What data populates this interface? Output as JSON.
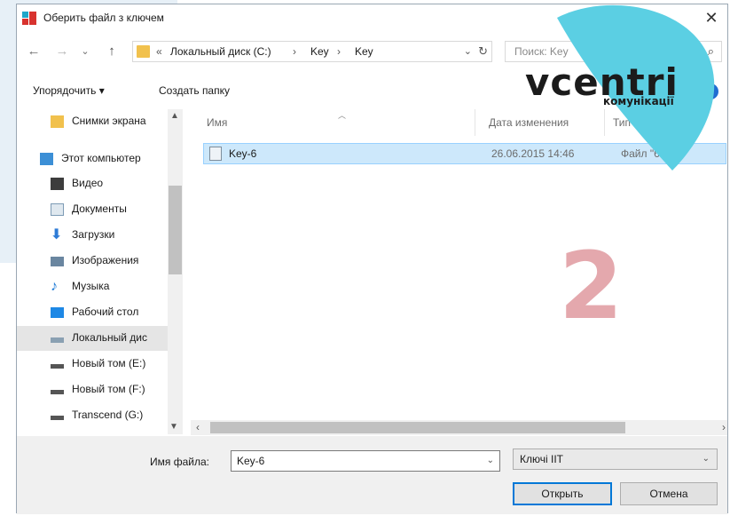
{
  "window": {
    "title": "Оберить файл з ключем",
    "close_glyph": "✕"
  },
  "nav": {
    "back": "←",
    "forward": "→",
    "recent": "⌄",
    "up": "↑"
  },
  "address": {
    "prefix": "«",
    "crumbs": [
      "Локальный диск (C:)",
      "Key",
      "Key"
    ],
    "separator": "›",
    "dropdown": "⌄",
    "refresh": "↻"
  },
  "search": {
    "placeholder": "Поиск: Key",
    "icon": "search-icon"
  },
  "commands": {
    "organize": "Упорядочить ▾",
    "new_folder": "Создать папку",
    "help": "?"
  },
  "sidebar": {
    "items": [
      {
        "label": "Снимки экрана",
        "icon": "folder-icon",
        "color": "#f1c14d"
      },
      {
        "label": "Этот компьютер",
        "icon": "computer-icon",
        "color": "#3c8fd6"
      },
      {
        "label": "Видео",
        "icon": "video-icon",
        "color": "#3d3d3d"
      },
      {
        "label": "Документы",
        "icon": "documents-icon",
        "color": "#7d9bb5"
      },
      {
        "label": "Загрузки",
        "icon": "downloads-icon",
        "color": "#2e7bd6"
      },
      {
        "label": "Изображения",
        "icon": "pictures-icon",
        "color": "#6a86a0"
      },
      {
        "label": "Музыка",
        "icon": "music-icon",
        "color": "#1c7ad6"
      },
      {
        "label": "Рабочий стол",
        "icon": "desktop-icon",
        "color": "#1e88e5"
      },
      {
        "label": "Локальный дис",
        "icon": "drive-icon",
        "color": "#8aa0b2",
        "selected": true
      },
      {
        "label": "Новый том (E:)",
        "icon": "drive-icon",
        "color": "#555555"
      },
      {
        "label": "Новый том (F:)",
        "icon": "drive-icon",
        "color": "#555555"
      },
      {
        "label": "Transcend (G:)",
        "icon": "drive-icon",
        "color": "#555555"
      }
    ]
  },
  "columns": {
    "name": "Имя",
    "date": "Дата изменения",
    "type": "Тип"
  },
  "files": [
    {
      "name": "Key-6",
      "date": "26.06.2015 14:46",
      "type": "Файл \"6\""
    }
  ],
  "bottom": {
    "filename_label": "Имя файла:",
    "filename_value": "Key-6",
    "filter_value": "Ключі ІІТ",
    "open_button": "Открыть",
    "cancel_button": "Отмена"
  },
  "overlay": {
    "step_number": "2",
    "logo_word": "vcentri",
    "logo_sub": "комунікації",
    "logo_color": "#5bcfe3"
  }
}
